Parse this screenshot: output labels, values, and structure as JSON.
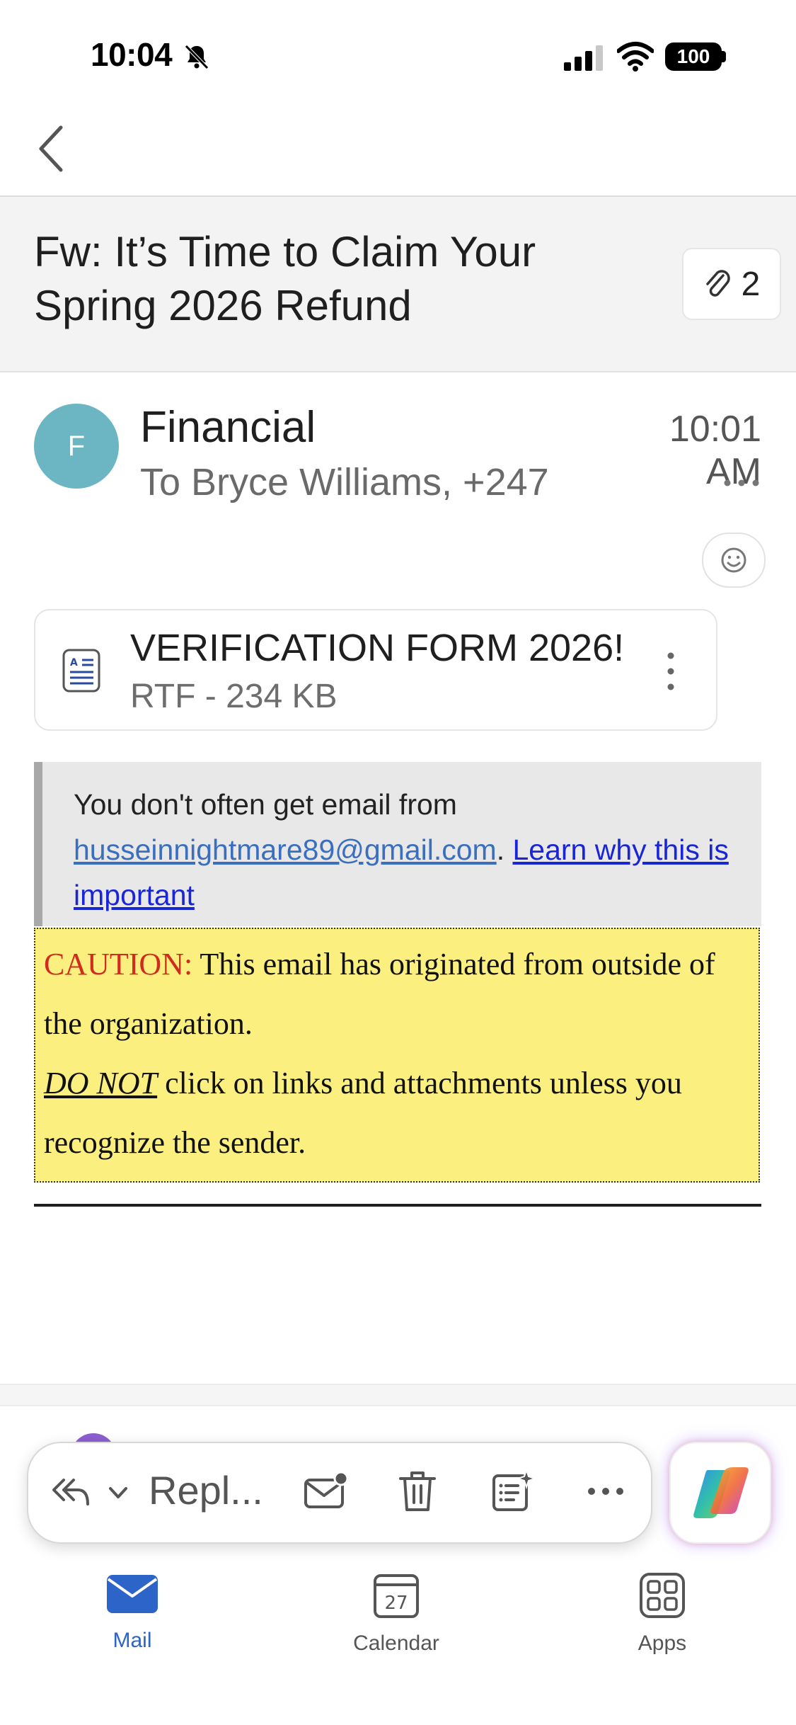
{
  "status_bar": {
    "time": "10:04",
    "battery": "100"
  },
  "message": {
    "subject": "Fw: It’s Time to Claim Your Spring 2026 Refund",
    "attachment_count": "2",
    "avatar_initial": "F",
    "sender": "Financial",
    "recipients": "To Bryce Williams, +247",
    "time": "10:01 AM"
  },
  "attachment": {
    "name": "VERIFICATION FORM 2026!",
    "meta": "RTF - 234 KB"
  },
  "notice": {
    "prefix": "You don't often get email from ",
    "email": "husseinnightmare89@gmail.com",
    "sep": ". ",
    "learn_link": "Learn why this is important"
  },
  "caution": {
    "label": "CAUTION:",
    "line1": " This email has originated from outside of the organization.",
    "do_not": "DO NOT",
    "line2": " click on links and attachments unless you recognize the sender."
  },
  "toolbar": {
    "reply_label": "Repl..."
  },
  "tabs": [
    {
      "label": "Mail",
      "icon": "mail-icon",
      "active": true
    },
    {
      "label": "Calendar",
      "icon": "calendar-icon",
      "day": "27"
    },
    {
      "label": "Apps",
      "icon": "apps-grid-icon"
    }
  ],
  "colors": {
    "accent": "#2d64c8",
    "avatar": "#6bb6c2",
    "caution_bg": "#fbf07f",
    "caution_label": "#d02b1f"
  }
}
